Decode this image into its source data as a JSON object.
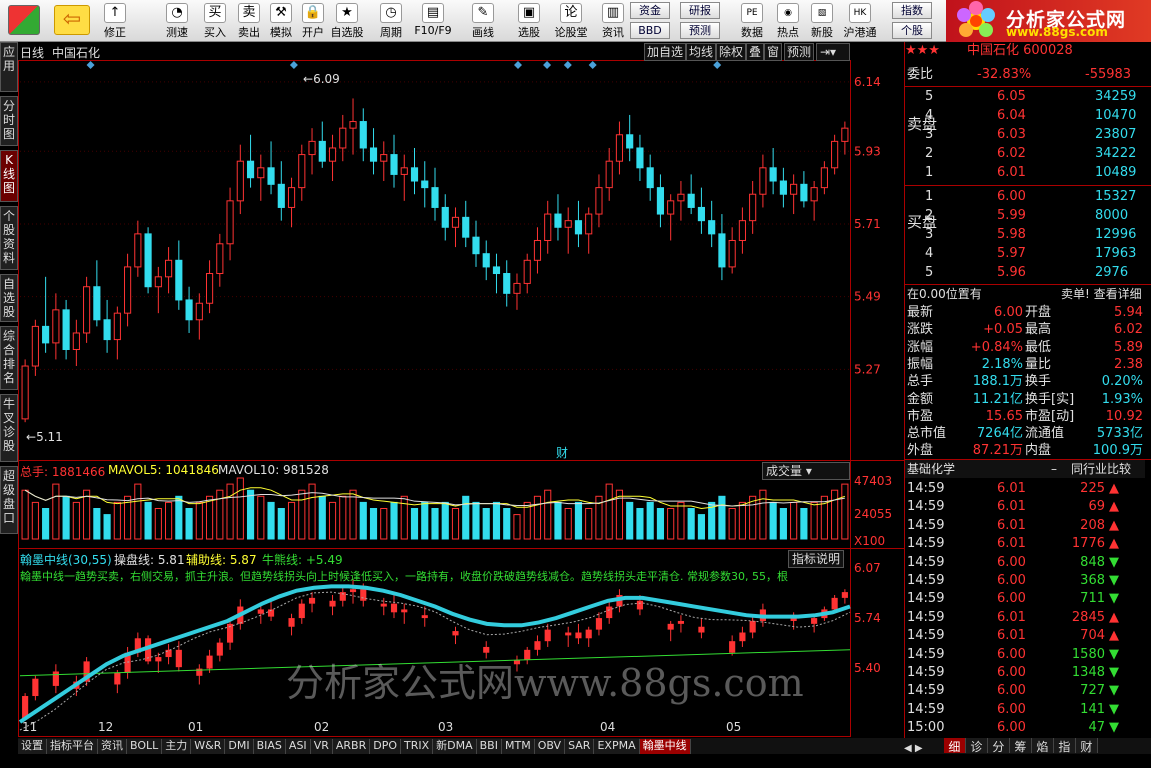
{
  "toolbar": {
    "items": [
      {
        "label": "",
        "icon": "windows-icon"
      },
      {
        "label": "",
        "icon": "back-icon"
      },
      {
        "label": "修正",
        "icon": "fix-icon"
      },
      {
        "label": "测速",
        "icon": "speed-icon"
      },
      {
        "label": "买入",
        "icon": "buy-icon"
      },
      {
        "label": "卖出",
        "icon": "sell-icon"
      },
      {
        "label": "模拟",
        "icon": "simulate-icon"
      },
      {
        "label": "开户",
        "icon": "lock-icon"
      },
      {
        "label": "自选股",
        "icon": "favorite-icon"
      },
      {
        "label": "周期",
        "icon": "period-icon"
      },
      {
        "label": "F10/F9",
        "icon": "f10-icon"
      },
      {
        "label": "画线",
        "icon": "draw-icon"
      },
      {
        "label": "选股",
        "icon": "select-icon"
      },
      {
        "label": "论股堂",
        "icon": "forum-icon"
      },
      {
        "label": "资讯",
        "icon": "news-icon"
      }
    ],
    "small_buttons": [
      "资金",
      "BBD",
      "研报",
      "预测"
    ],
    "right_items": [
      {
        "label": "数据",
        "icon": "pe-icon"
      },
      {
        "label": "热点",
        "icon": "hot-icon"
      },
      {
        "label": "新股",
        "icon": "newstock-icon"
      },
      {
        "label": "沪港通",
        "icon": "hk-icon"
      }
    ],
    "index_buttons": [
      "指数",
      "个股"
    ],
    "logo_title": "分析家公式网",
    "logo_url": "www.88gs.com"
  },
  "sidenav": [
    "应用",
    "分时图",
    "K线图",
    "个股资料",
    "自选股",
    "综合排名",
    "牛叉诊股",
    "超级盘口"
  ],
  "chart_header": {
    "period": "日线",
    "name": "中国石化"
  },
  "chart_buttons": [
    "加自选",
    "均线",
    "除权",
    "叠",
    "窗",
    "预测"
  ],
  "price_labels": [
    "6.14",
    "5.93",
    "5.71",
    "5.49",
    "5.27"
  ],
  "high_label": "6.09",
  "low_label": "5.11",
  "cai_label": "财",
  "volume": {
    "total_label": "总手: 1881466",
    "mavol5": "MAVOL5: 1041846",
    "mavol10": "MAVOL10: 981528",
    "dropdown": "成交量",
    "axis": [
      "47403",
      "24055",
      "X100"
    ]
  },
  "indicator": {
    "title": "翰墨中线(30,55)",
    "line1": "操盘线: 5.81",
    "line2": "辅助线: 5.87",
    "line3": "牛熊线: +5.49",
    "desc": "翰墨中线一趋势买卖，右侧交易，抓主升浪。但趋势线拐头向上时候逢低买入，一路持有，收盘价跌破趋势线减仓。趋势线拐头走平清仓. 常规参数30, 55，根",
    "button": "指标说明",
    "axis": [
      "6.07",
      "5.74",
      "5.40"
    ]
  },
  "months": [
    "11",
    "12",
    "01",
    "02",
    "03",
    "04",
    "05"
  ],
  "watermark": "分析家公式网www.88gs.com",
  "chart_data": {
    "type": "candlestick",
    "title": "中国石化 日线",
    "ylim": [
      5.05,
      6.17
    ],
    "candles": [
      [
        5.12,
        5.3,
        5.11,
        5.28
      ],
      [
        5.28,
        5.42,
        5.25,
        5.4
      ],
      [
        5.4,
        5.55,
        5.32,
        5.35
      ],
      [
        5.35,
        5.5,
        5.3,
        5.45
      ],
      [
        5.45,
        5.48,
        5.3,
        5.33
      ],
      [
        5.33,
        5.42,
        5.28,
        5.38
      ],
      [
        5.38,
        5.55,
        5.35,
        5.52
      ],
      [
        5.52,
        5.6,
        5.4,
        5.42
      ],
      [
        5.42,
        5.48,
        5.32,
        5.36
      ],
      [
        5.36,
        5.46,
        5.3,
        5.44
      ],
      [
        5.44,
        5.62,
        5.4,
        5.58
      ],
      [
        5.58,
        5.72,
        5.55,
        5.68
      ],
      [
        5.68,
        5.7,
        5.5,
        5.52
      ],
      [
        5.52,
        5.58,
        5.44,
        5.55
      ],
      [
        5.55,
        5.64,
        5.5,
        5.6
      ],
      [
        5.6,
        5.66,
        5.45,
        5.48
      ],
      [
        5.48,
        5.52,
        5.38,
        5.42
      ],
      [
        5.42,
        5.5,
        5.36,
        5.47
      ],
      [
        5.47,
        5.6,
        5.44,
        5.56
      ],
      [
        5.56,
        5.68,
        5.52,
        5.65
      ],
      [
        5.65,
        5.82,
        5.6,
        5.78
      ],
      [
        5.78,
        5.95,
        5.74,
        5.9
      ],
      [
        5.9,
        5.98,
        5.82,
        5.85
      ],
      [
        5.85,
        5.92,
        5.78,
        5.88
      ],
      [
        5.88,
        5.96,
        5.8,
        5.83
      ],
      [
        5.83,
        5.9,
        5.72,
        5.76
      ],
      [
        5.76,
        5.85,
        5.7,
        5.82
      ],
      [
        5.82,
        5.95,
        5.78,
        5.92
      ],
      [
        5.92,
        6.0,
        5.86,
        5.96
      ],
      [
        5.96,
        6.02,
        5.88,
        5.9
      ],
      [
        5.9,
        5.98,
        5.84,
        5.94
      ],
      [
        5.94,
        6.04,
        5.9,
        6.0
      ],
      [
        6.0,
        6.09,
        5.92,
        6.02
      ],
      [
        6.02,
        6.06,
        5.9,
        5.94
      ],
      [
        5.94,
        6.0,
        5.86,
        5.9
      ],
      [
        5.9,
        5.96,
        5.84,
        5.92
      ],
      [
        5.92,
        5.98,
        5.82,
        5.86
      ],
      [
        5.86,
        5.92,
        5.78,
        5.88
      ],
      [
        5.88,
        5.94,
        5.8,
        5.84
      ],
      [
        5.84,
        5.9,
        5.76,
        5.82
      ],
      [
        5.82,
        5.88,
        5.72,
        5.76
      ],
      [
        5.76,
        5.8,
        5.66,
        5.7
      ],
      [
        5.7,
        5.76,
        5.64,
        5.73
      ],
      [
        5.73,
        5.78,
        5.64,
        5.67
      ],
      [
        5.67,
        5.72,
        5.58,
        5.62
      ],
      [
        5.62,
        5.66,
        5.54,
        5.58
      ],
      [
        5.58,
        5.62,
        5.5,
        5.56
      ],
      [
        5.56,
        5.6,
        5.46,
        5.5
      ],
      [
        5.5,
        5.56,
        5.45,
        5.53
      ],
      [
        5.53,
        5.62,
        5.5,
        5.6
      ],
      [
        5.6,
        5.7,
        5.56,
        5.66
      ],
      [
        5.66,
        5.78,
        5.62,
        5.74
      ],
      [
        5.74,
        5.8,
        5.66,
        5.7
      ],
      [
        5.7,
        5.76,
        5.62,
        5.72
      ],
      [
        5.72,
        5.78,
        5.64,
        5.68
      ],
      [
        5.68,
        5.76,
        5.62,
        5.74
      ],
      [
        5.74,
        5.86,
        5.7,
        5.82
      ],
      [
        5.82,
        5.94,
        5.78,
        5.9
      ],
      [
        5.9,
        6.02,
        5.86,
        5.98
      ],
      [
        5.98,
        6.04,
        5.9,
        5.94
      ],
      [
        5.94,
        5.98,
        5.84,
        5.88
      ],
      [
        5.88,
        5.92,
        5.78,
        5.82
      ],
      [
        5.82,
        5.86,
        5.7,
        5.74
      ],
      [
        5.74,
        5.8,
        5.66,
        5.78
      ],
      [
        5.78,
        5.84,
        5.72,
        5.8
      ],
      [
        5.8,
        5.86,
        5.74,
        5.76
      ],
      [
        5.76,
        5.82,
        5.68,
        5.72
      ],
      [
        5.72,
        5.78,
        5.64,
        5.68
      ],
      [
        5.68,
        5.74,
        5.54,
        5.58
      ],
      [
        5.58,
        5.7,
        5.56,
        5.66
      ],
      [
        5.66,
        5.76,
        5.62,
        5.72
      ],
      [
        5.72,
        5.84,
        5.68,
        5.8
      ],
      [
        5.8,
        5.92,
        5.76,
        5.88
      ],
      [
        5.88,
        5.94,
        5.8,
        5.84
      ],
      [
        5.84,
        5.88,
        5.76,
        5.8
      ],
      [
        5.8,
        5.86,
        5.74,
        5.83
      ],
      [
        5.83,
        5.87,
        5.76,
        5.78
      ],
      [
        5.78,
        5.84,
        5.72,
        5.82
      ],
      [
        5.82,
        5.9,
        5.8,
        5.88
      ],
      [
        5.88,
        5.98,
        5.86,
        5.96
      ],
      [
        5.96,
        6.02,
        5.92,
        6.0
      ]
    ],
    "volumes": [
      8,
      6,
      5,
      9,
      7,
      6,
      8,
      5,
      4,
      6,
      7,
      9,
      6,
      5,
      6,
      7,
      5,
      6,
      7,
      8,
      9,
      10,
      8,
      7,
      6,
      5,
      6,
      8,
      9,
      7,
      6,
      7,
      8,
      6,
      5,
      5,
      6,
      7,
      5,
      6,
      5,
      6,
      5,
      7,
      6,
      5,
      6,
      5,
      4,
      6,
      7,
      8,
      6,
      5,
      6,
      5,
      7,
      9,
      8,
      6,
      5,
      6,
      5,
      5,
      6,
      5,
      4,
      6,
      7,
      5,
      6,
      7,
      8,
      6,
      5,
      6,
      5,
      6,
      7,
      8,
      9
    ],
    "indicator_trend": [
      5.1,
      5.18,
      5.26,
      5.34,
      5.42,
      5.5,
      5.56,
      5.6,
      5.64,
      5.68,
      5.72,
      5.76,
      5.8,
      5.86,
      5.92,
      5.97,
      6.01,
      6.03,
      6.04,
      6.04,
      6.03,
      6.01,
      5.98,
      5.94,
      5.9,
      5.85,
      5.81,
      5.78,
      5.77,
      5.77,
      5.79,
      5.82,
      5.86,
      5.9,
      5.94,
      5.96,
      5.96,
      5.94,
      5.92,
      5.9,
      5.88,
      5.86,
      5.84,
      5.83,
      5.83,
      5.83,
      5.84,
      5.86,
      5.9
    ]
  },
  "right_panel": {
    "title": "中国石化 600028",
    "weibi_label": "委比",
    "weibi_value": "-32.83%",
    "weicha_value": "-55983",
    "sell_label": "卖盘",
    "buy_label": "买盘",
    "asks": [
      {
        "lvl": "5",
        "price": "6.05",
        "vol": "34259"
      },
      {
        "lvl": "4",
        "price": "6.04",
        "vol": "10470"
      },
      {
        "lvl": "3",
        "price": "6.03",
        "vol": "23807"
      },
      {
        "lvl": "2",
        "price": "6.02",
        "vol": "34222"
      },
      {
        "lvl": "1",
        "price": "6.01",
        "vol": "10489"
      }
    ],
    "bids": [
      {
        "lvl": "1",
        "price": "6.00",
        "vol": "15327"
      },
      {
        "lvl": "2",
        "price": "5.99",
        "vol": "8000"
      },
      {
        "lvl": "3",
        "price": "5.98",
        "vol": "12996"
      },
      {
        "lvl": "4",
        "price": "5.97",
        "vol": "17963"
      },
      {
        "lvl": "5",
        "price": "5.96",
        "vol": "2976"
      }
    ],
    "position_text": "在0.00位置有",
    "sell_order_text": "卖单! 查看详细",
    "stats": [
      {
        "l1": "最新",
        "v1": "6.00",
        "l2": "开盘",
        "v2": "5.94"
      },
      {
        "l1": "涨跌",
        "v1": "+0.05",
        "l2": "最高",
        "v2": "6.02"
      },
      {
        "l1": "涨幅",
        "v1": "+0.84%",
        "l2": "最低",
        "v2": "5.89"
      },
      {
        "l1": "振幅",
        "v1": "2.18%",
        "l2": "量比",
        "v2": "2.38"
      },
      {
        "l1": "总手",
        "v1": "188.1万",
        "l2": "换手",
        "v2": "0.20%"
      },
      {
        "l1": "金额",
        "v1": "11.21亿",
        "l2": "换手[实]",
        "v2": "1.93%"
      },
      {
        "l1": "市盈",
        "v1": "15.65",
        "l2": "市盈[动]",
        "v2": "10.92"
      },
      {
        "l1": "总市值",
        "v1": "7264亿",
        "l2": "流通值",
        "v2": "5733亿"
      },
      {
        "l1": "外盘",
        "v1": "87.21万",
        "l2": "内盘",
        "v2": "100.9万"
      }
    ],
    "industry_label": "基础化学",
    "industry_compare": "同行业比较",
    "ticks": [
      {
        "t": "14:59",
        "p": "6.01",
        "v": "225",
        "d": "up"
      },
      {
        "t": "14:59",
        "p": "6.01",
        "v": "69",
        "d": "up"
      },
      {
        "t": "14:59",
        "p": "6.01",
        "v": "208",
        "d": "up"
      },
      {
        "t": "14:59",
        "p": "6.01",
        "v": "1776",
        "d": "up"
      },
      {
        "t": "14:59",
        "p": "6.00",
        "v": "848",
        "d": "down"
      },
      {
        "t": "14:59",
        "p": "6.00",
        "v": "368",
        "d": "down"
      },
      {
        "t": "14:59",
        "p": "6.00",
        "v": "711",
        "d": "down"
      },
      {
        "t": "14:59",
        "p": "6.01",
        "v": "2845",
        "d": "up"
      },
      {
        "t": "14:59",
        "p": "6.01",
        "v": "704",
        "d": "up"
      },
      {
        "t": "14:59",
        "p": "6.00",
        "v": "1580",
        "d": "down"
      },
      {
        "t": "14:59",
        "p": "6.00",
        "v": "1348",
        "d": "down"
      },
      {
        "t": "14:59",
        "p": "6.00",
        "v": "727",
        "d": "down"
      },
      {
        "t": "14:59",
        "p": "6.00",
        "v": "141",
        "d": "down"
      },
      {
        "t": "15:00",
        "p": "6.00",
        "v": "47",
        "d": "down"
      }
    ]
  },
  "bottom_tabs": [
    "设置",
    "指标平台",
    "资讯",
    "BOLL",
    "主力",
    "W&R",
    "DMI",
    "BIAS",
    "ASI",
    "VR",
    "ARBR",
    "DPO",
    "TRIX",
    "新DMA",
    "BBI",
    "MTM",
    "OBV",
    "SAR",
    "EXPMA",
    "翰墨中线"
  ],
  "right_tabs": [
    "细",
    "诊",
    "分",
    "筹",
    "焰",
    "指",
    "财"
  ],
  "colors": {
    "up": "#ff3333",
    "down": "#33ddee",
    "trend": "#33ccdd",
    "bull": "#33dd33"
  }
}
